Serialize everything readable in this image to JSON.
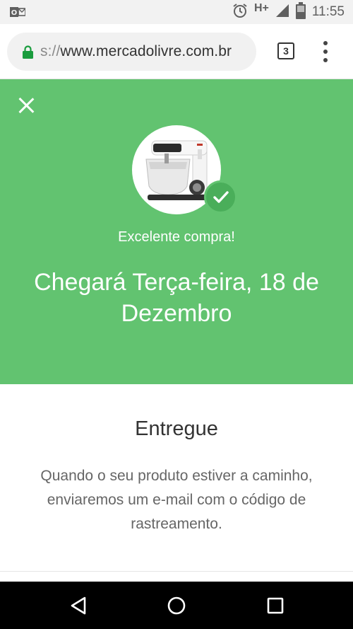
{
  "status_bar": {
    "app_icon": "outlook-icon",
    "alarm_icon": "alarm-clock-icon",
    "network": "H+",
    "signal_icon": "cell-signal-icon",
    "battery_icon": "battery-icon",
    "time": "11:55"
  },
  "browser": {
    "url_scheme": "s://",
    "url_host": "www.mercadolivre.com.br",
    "tab_count": "3",
    "lock_color": "#1a9c3e"
  },
  "hero": {
    "background_color": "#62c370",
    "subtitle": "Excelente compra!",
    "headline": "Chegará Terça-feira, 18 de Dezembro",
    "product_image": "stand-mixer-image"
  },
  "content": {
    "title": "Entregue",
    "text": "Quando o seu produto estiver a caminho, enviaremos um e-mail com o código de rastreamento."
  },
  "nav_bar": {
    "back": "back-icon",
    "home": "home-icon",
    "recents": "recents-icon"
  }
}
